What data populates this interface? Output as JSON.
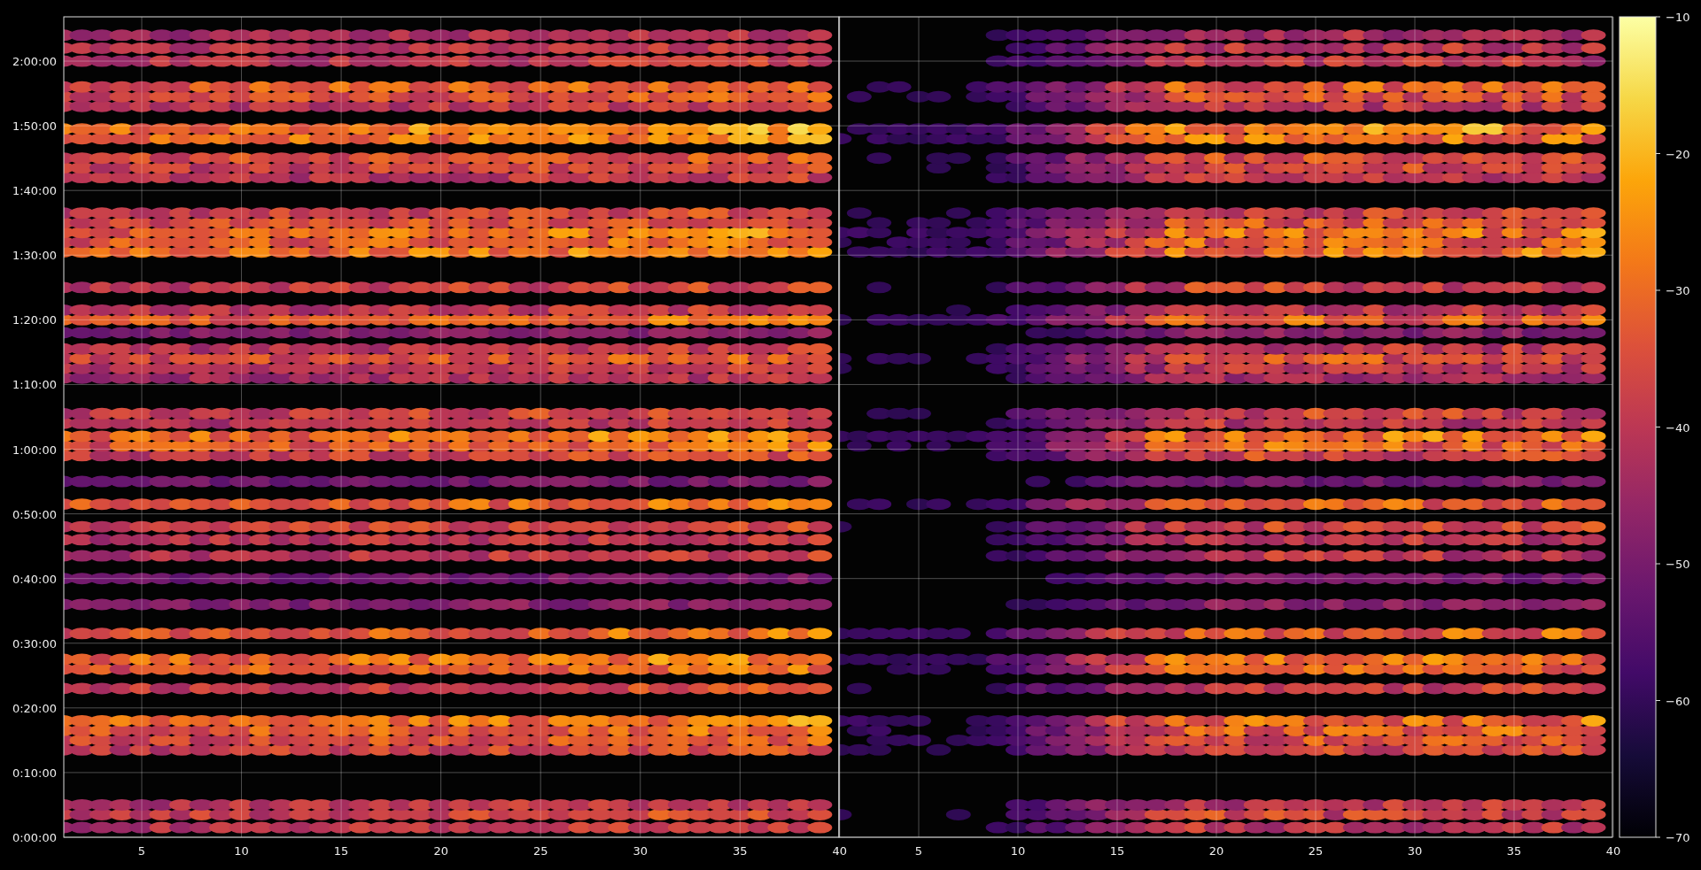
{
  "plot": {
    "y_axis_labels": [
      "2:00:00",
      "1:50:00",
      "1:40:00",
      "1:30:00",
      "1:20:00",
      "1:10:00",
      "1:00:00",
      "0:50:00",
      "0:40:00",
      "0:30:00",
      "0:20:00",
      "0:10:00",
      "0:00:00"
    ],
    "left_panel_x_labels": [
      "5",
      "10",
      "15",
      "20",
      "25",
      "30",
      "35",
      "40"
    ],
    "right_panel_x_labels": [
      "5",
      "10",
      "15",
      "20",
      "25",
      "30",
      "35",
      "40"
    ],
    "colorbar_labels": [
      "−10",
      "−20",
      "−30",
      "−40",
      "−50",
      "−60",
      "−70"
    ]
  }
}
